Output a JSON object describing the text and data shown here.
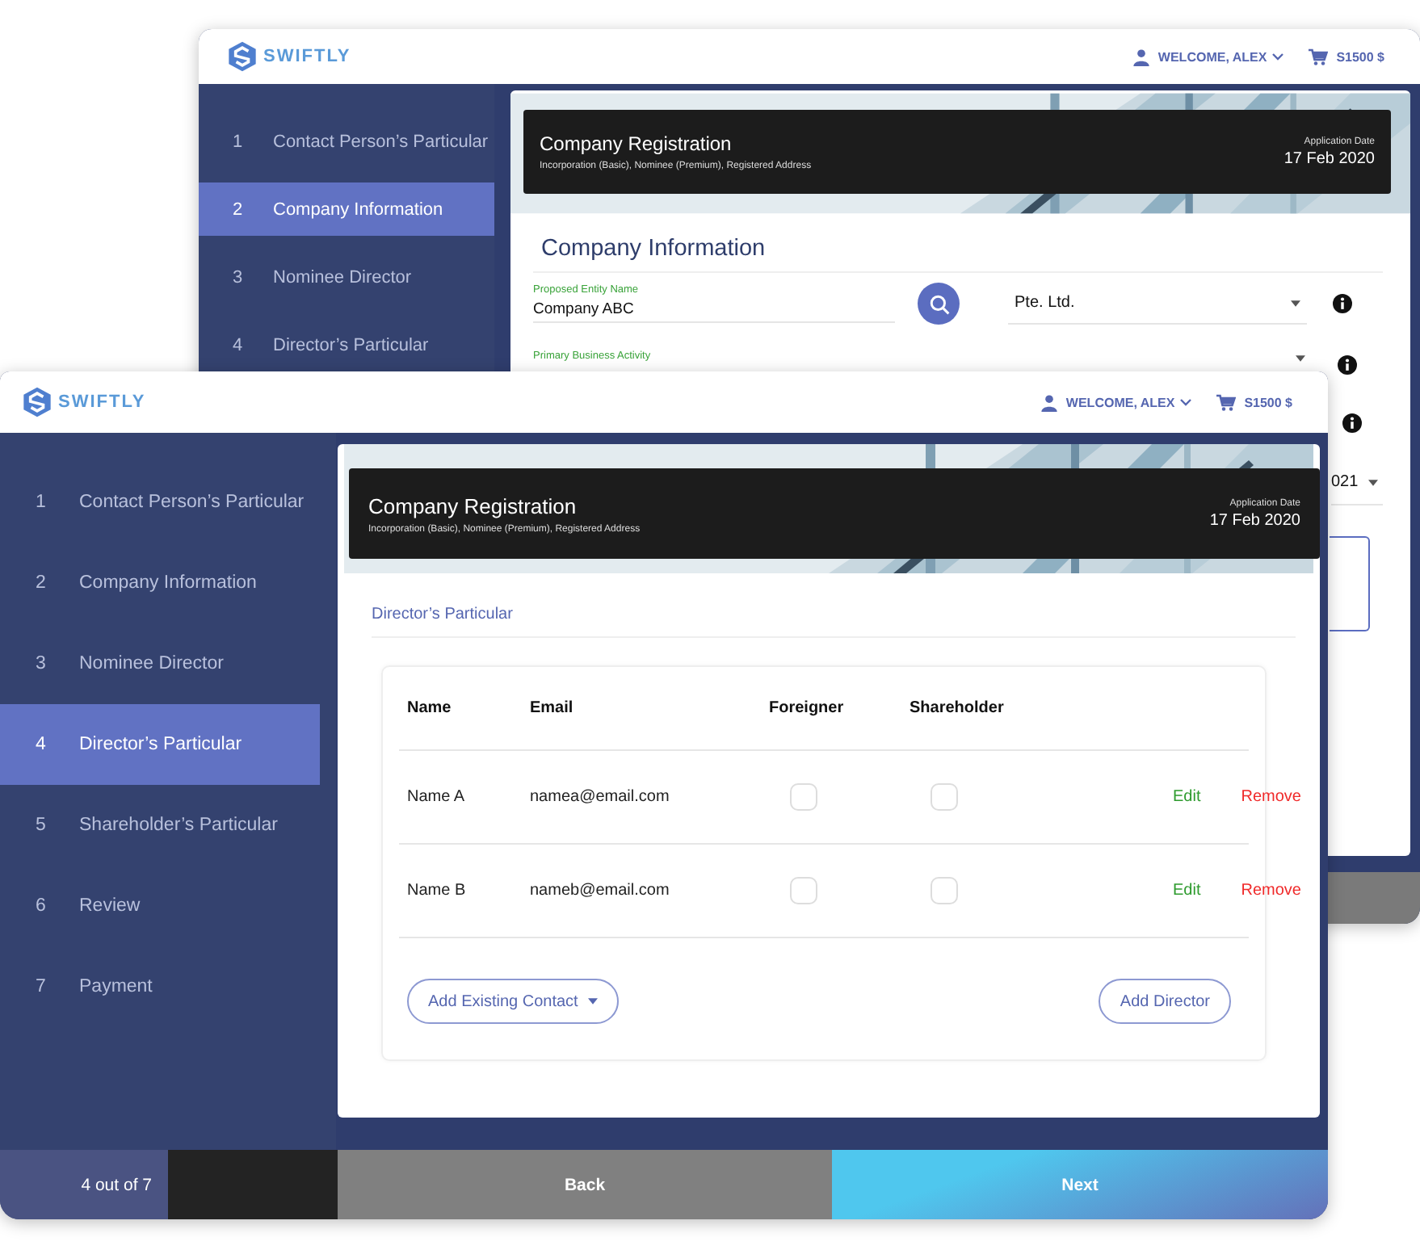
{
  "windows": [
    {
      "kind": "company_information",
      "header": {
        "logo": "SWIFTLY",
        "user": "WELCOME, ALEX",
        "cart": "S1500 $"
      },
      "steps": [
        {
          "number": "1",
          "label": "Contact Person’s Particular",
          "selected": false
        },
        {
          "number": "2",
          "label": "Company Information",
          "selected": true
        },
        {
          "number": "3",
          "label": "Nominee Director",
          "selected": false
        },
        {
          "number": "4",
          "label": "Director’s Particular",
          "selected": false
        }
      ],
      "banner": {
        "title": "Company Registration",
        "subtitle": "Incorporation (Basic), Nominee (Premium), Registered Address",
        "date_label": "Application Date",
        "date": "17 Feb 2020"
      },
      "form": {
        "heading": "Company Information",
        "entity_name": {
          "label": "Proposed Entity Name",
          "value": "Company ABC"
        },
        "entity_type": "Pte. Ltd.",
        "business_activity": {
          "label": "Primary Business Activity"
        },
        "year": "021"
      }
    },
    {
      "kind": "directors",
      "header": {
        "logo": "SWIFTLY",
        "user": "WELCOME, ALEX",
        "cart": "S1500 $"
      },
      "steps": [
        {
          "number": "1",
          "label": "Contact Person’s Particular",
          "selected": false
        },
        {
          "number": "2",
          "label": "Company Information",
          "selected": false
        },
        {
          "number": "3",
          "label": "Nominee Director",
          "selected": false
        },
        {
          "number": "4",
          "label": "Director’s Particular",
          "selected": true
        },
        {
          "number": "5",
          "label": "Shareholder’s Particular",
          "selected": false
        },
        {
          "number": "6",
          "label": "Review",
          "selected": false
        },
        {
          "number": "7",
          "label": "Payment",
          "selected": false
        }
      ],
      "banner": {
        "title": "Company Registration",
        "subtitle": "Incorporation (Basic), Nominee (Premium), Registered Address",
        "date_label": "Application Date",
        "date": "17 Feb 2020"
      },
      "section": "Director’s Particular",
      "table": {
        "columns": [
          "Name",
          "Email",
          "Foreigner",
          "Shareholder"
        ],
        "rows": [
          {
            "name": "Name A",
            "email": "namea@email.com",
            "foreigner": false,
            "shareholder": false,
            "edit": "Edit",
            "remove": "Remove"
          },
          {
            "name": "Name B",
            "email": "nameb@email.com",
            "foreigner": false,
            "shareholder": false,
            "edit": "Edit",
            "remove": "Remove"
          }
        ]
      },
      "add_contact": "Add Existing Contact",
      "add_director": "Add Director",
      "footer": {
        "progress": "4 out of 7",
        "back": "Back",
        "next": "Next"
      }
    }
  ]
}
